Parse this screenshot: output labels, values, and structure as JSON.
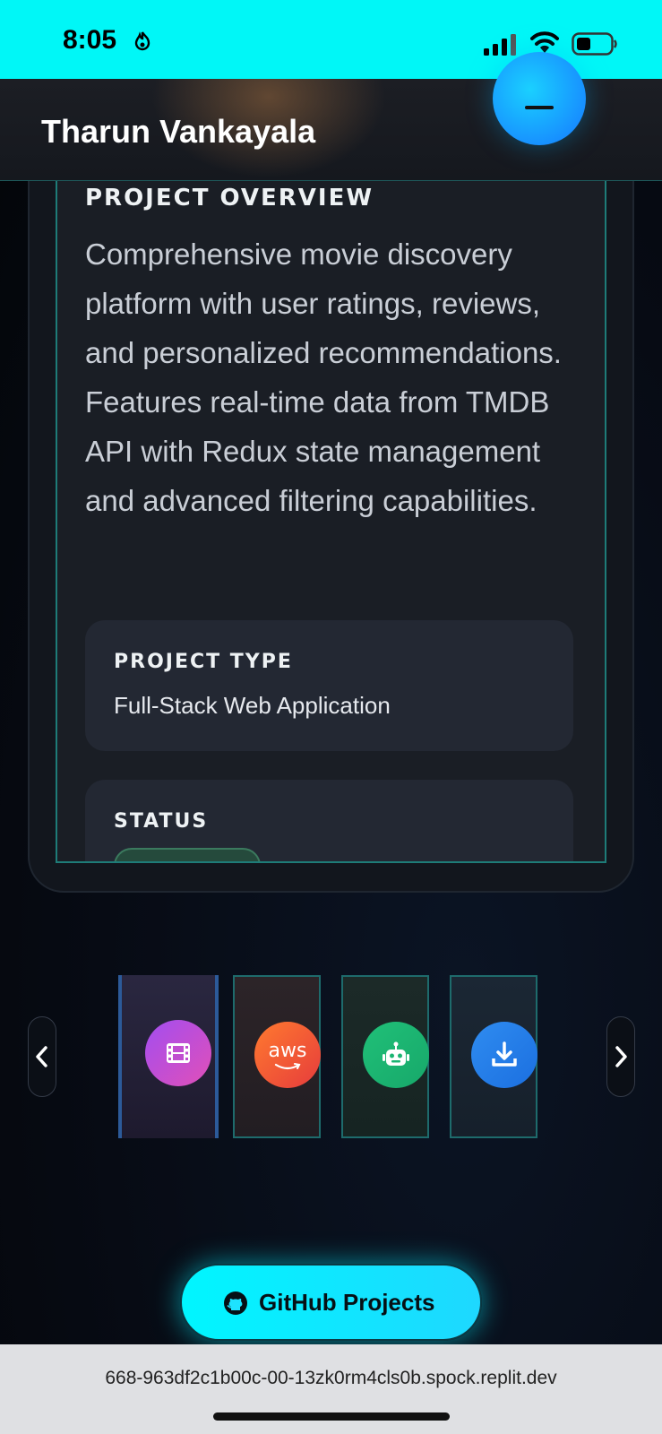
{
  "status_bar": {
    "time": "8:05",
    "icons": [
      "flame-icon",
      "signal-icon",
      "wifi-icon",
      "battery-icon"
    ]
  },
  "header": {
    "title": "Tharun Vankayala",
    "menu_icon": "menu-icon"
  },
  "project": {
    "overview_title": "PROJECT OVERVIEW",
    "overview_text": "Comprehensive movie discovery platform with user ratings, reviews, and personalized recommendations. Features real-time data from TMDB API with Redux state management and advanced filtering capabilities.",
    "type_label": "PROJECT TYPE",
    "type_value": "Full-Stack Web Application",
    "status_label": "STATUS"
  },
  "carousel": {
    "prev_icon": "chevron-left-icon",
    "next_icon": "chevron-right-icon",
    "items": [
      {
        "icon": "film-icon",
        "active": true
      },
      {
        "icon": "aws-icon",
        "text": "aws"
      },
      {
        "icon": "robot-icon"
      },
      {
        "icon": "download-icon"
      }
    ]
  },
  "github_button": {
    "label": "GitHub Projects",
    "icon": "github-icon"
  },
  "browser": {
    "url": "668-963df2c1b00c-00-13zk0rm4cls0b.spock.replit.dev"
  },
  "colors": {
    "accent": "#00f7f7",
    "panel_border": "#1e7c78",
    "background": "#070b14"
  }
}
